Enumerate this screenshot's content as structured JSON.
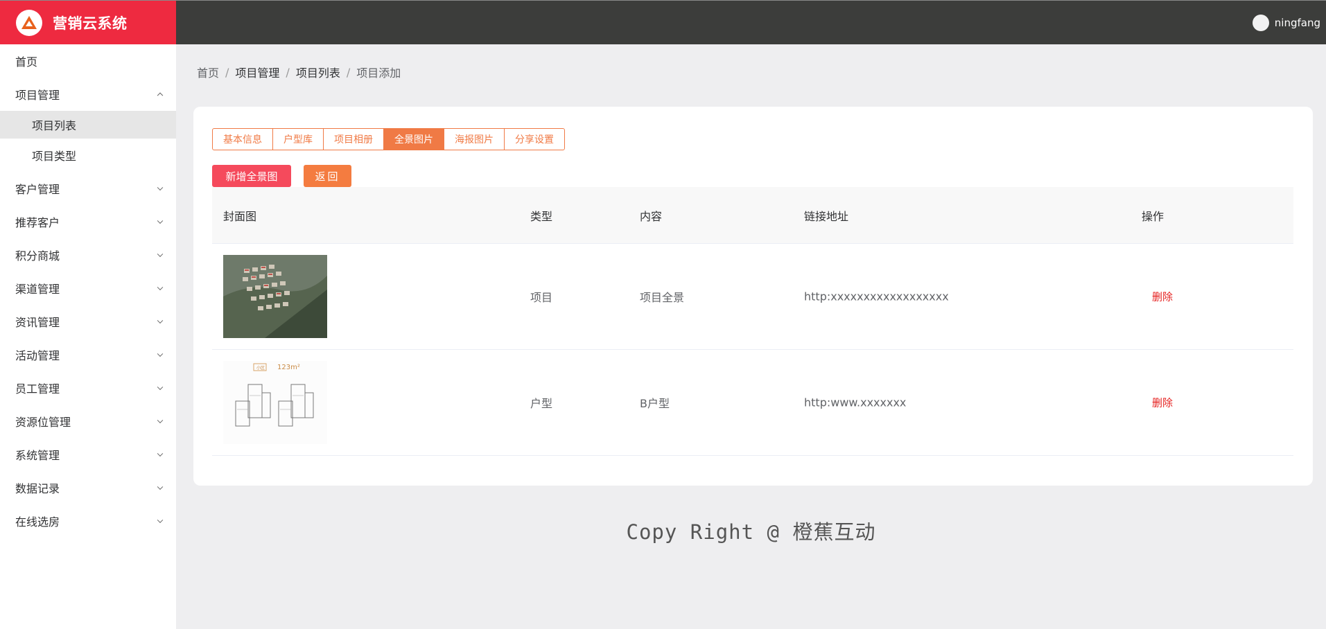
{
  "app": {
    "title": "营销云系统",
    "logo_icon": "triangle-logo-icon",
    "brand_color": "#ee2a40"
  },
  "user": {
    "name": "ningfang"
  },
  "sidebar": {
    "home": "首页",
    "project": {
      "label": "项目管理",
      "children": [
        "项目列表",
        "项目类型"
      ]
    },
    "items": [
      "客户管理",
      "推荐客户",
      "积分商城",
      "渠道管理",
      "资讯管理",
      "活动管理",
      "员工管理",
      "资源位管理",
      "系统管理",
      "数据记录",
      "在线选房"
    ]
  },
  "breadcrumb": [
    "首页",
    "项目管理",
    "项目列表",
    "项目添加"
  ],
  "tabs": [
    "基本信息",
    "户型库",
    "项目相册",
    "全景图片",
    "海报图片",
    "分享设置"
  ],
  "active_tab": "全景图片",
  "buttons": {
    "add": "新增全景图",
    "back": "返回"
  },
  "table": {
    "headers": [
      "封面图",
      "类型",
      "内容",
      "链接地址",
      "操作"
    ],
    "rows": [
      {
        "type": "项目",
        "content": "项目全景",
        "link": "http:xxxxxxxxxxxxxxxxxx",
        "action": "删除"
      },
      {
        "type": "户型",
        "content": "B户型",
        "link": "http:www.xxxxxxx",
        "action": "删除"
      }
    ]
  },
  "floorplan": {
    "badge": "小区",
    "area": "123m²"
  },
  "footer": "Copy Right @ 橙蕉互动",
  "accent_color": "#f07a45"
}
